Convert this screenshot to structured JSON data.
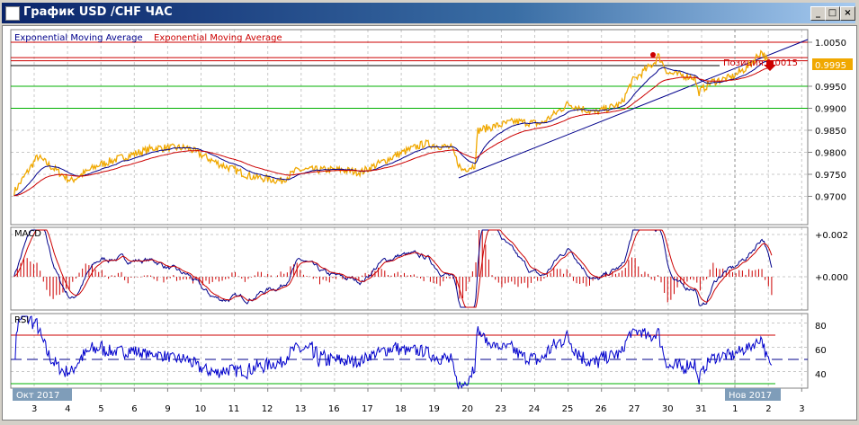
{
  "window": {
    "title": "График USD /CHF  ЧАС",
    "minimize": "_",
    "maximize": "□",
    "close": "×"
  },
  "legend": {
    "ema_blue": "Exponential  Moving  Average",
    "ema_red": "Exponential  Moving  Average"
  },
  "price_axis": {
    "ticks": [
      "1.0050",
      "0.9950",
      "0.9900",
      "0.9850",
      "0.9800",
      "0.9750",
      "0.9700"
    ],
    "tick_values": [
      1.005,
      0.995,
      0.99,
      0.985,
      0.98,
      0.975,
      0.97
    ],
    "current_price": "0.9995"
  },
  "position_label": "Позиция 1.0015",
  "levels": {
    "red": [
      1.005,
      1.0015,
      1.0008
    ],
    "black": [
      0.9997
    ],
    "green": [
      0.995,
      0.99
    ]
  },
  "macd": {
    "label": "MACD",
    "ticks": [
      "+0.002",
      "+0.000"
    ]
  },
  "rsi": {
    "label": "RSI",
    "ticks": [
      "80",
      "60",
      "40"
    ],
    "levels": {
      "upper": 70,
      "mid": 50,
      "lower": 30
    }
  },
  "date_axis": {
    "days": [
      "3",
      "4",
      "5",
      "6",
      "9",
      "10",
      "11",
      "12",
      "13",
      "16",
      "17",
      "18",
      "19",
      "20",
      "23",
      "24",
      "25",
      "26",
      "27",
      "30",
      "31",
      "1",
      "2",
      "3"
    ],
    "month_left": "Окт 2017",
    "month_right": "Нов 2017"
  },
  "price_anchors": [
    [
      -0.6,
      0.971
    ],
    [
      0.1,
      0.979
    ],
    [
      1.1,
      0.9735
    ],
    [
      1.9,
      0.977
    ],
    [
      2.5,
      0.9785
    ],
    [
      3.6,
      0.981
    ],
    [
      4.6,
      0.981
    ],
    [
      5.5,
      0.9775
    ],
    [
      6.5,
      0.9745
    ],
    [
      7.4,
      0.9735
    ],
    [
      7.9,
      0.976
    ],
    [
      9.2,
      0.976
    ],
    [
      9.8,
      0.9755
    ],
    [
      10.9,
      0.9795
    ],
    [
      11.7,
      0.982
    ],
    [
      12.5,
      0.981
    ],
    [
      12.8,
      0.976
    ],
    [
      13.2,
      0.977
    ],
    [
      13.3,
      0.985
    ],
    [
      14.4,
      0.987
    ],
    [
      15.2,
      0.9865
    ],
    [
      16,
      0.991
    ],
    [
      16.8,
      0.989
    ],
    [
      17.6,
      0.991
    ],
    [
      17.9,
      0.996
    ],
    [
      18.6,
      1.0005
    ],
    [
      18.7,
      1.002
    ],
    [
      19,
      0.998
    ],
    [
      19.8,
      0.997
    ],
    [
      19.9,
      0.9935
    ],
    [
      20.3,
      0.996
    ],
    [
      20.9,
      0.997
    ],
    [
      21.4,
      0.9995
    ],
    [
      21.8,
      1.003
    ],
    [
      22.1,
      0.999
    ]
  ],
  "colors": {
    "price": "#f0a800",
    "ema_fast": "#00008b",
    "ema_slow": "#cc0000",
    "green": "#00b000",
    "title_bar": "#0a246a"
  }
}
